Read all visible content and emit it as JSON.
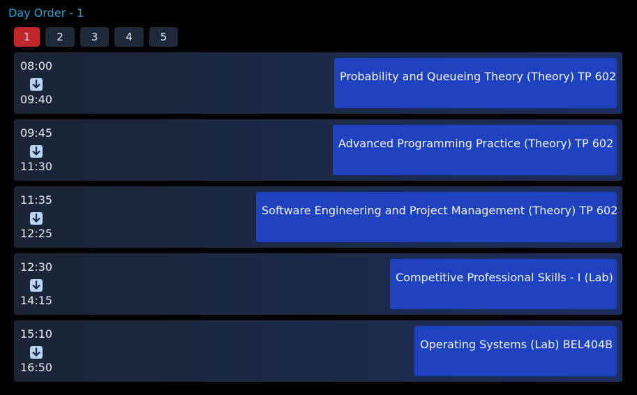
{
  "title": "Day Order - 1",
  "tabs": [
    "1",
    "2",
    "3",
    "4",
    "5"
  ],
  "active_tab": "1",
  "arrow_icon": "arrow-down-icon",
  "colors": {
    "title": "#1ea0d8",
    "active_tab": "#c0262a",
    "tab": "#1e2a39",
    "course_card": "#1f43c0"
  },
  "slots": [
    {
      "start": "08:00",
      "end": "09:40",
      "course": "Probability and Queueing Theory (Theory) TP 602"
    },
    {
      "start": "09:45",
      "end": "11:30",
      "course": "Advanced Programming Practice (Theory) TP 602"
    },
    {
      "start": "11:35",
      "end": "12:25",
      "course": "Software Engineering and Project Management (Theory) TP 602"
    },
    {
      "start": "12:30",
      "end": "14:15",
      "course": "Competitive Professional Skills - I (Lab)"
    },
    {
      "start": "15:10",
      "end": "16:50",
      "course": "Operating Systems (Lab) BEL404B"
    }
  ]
}
